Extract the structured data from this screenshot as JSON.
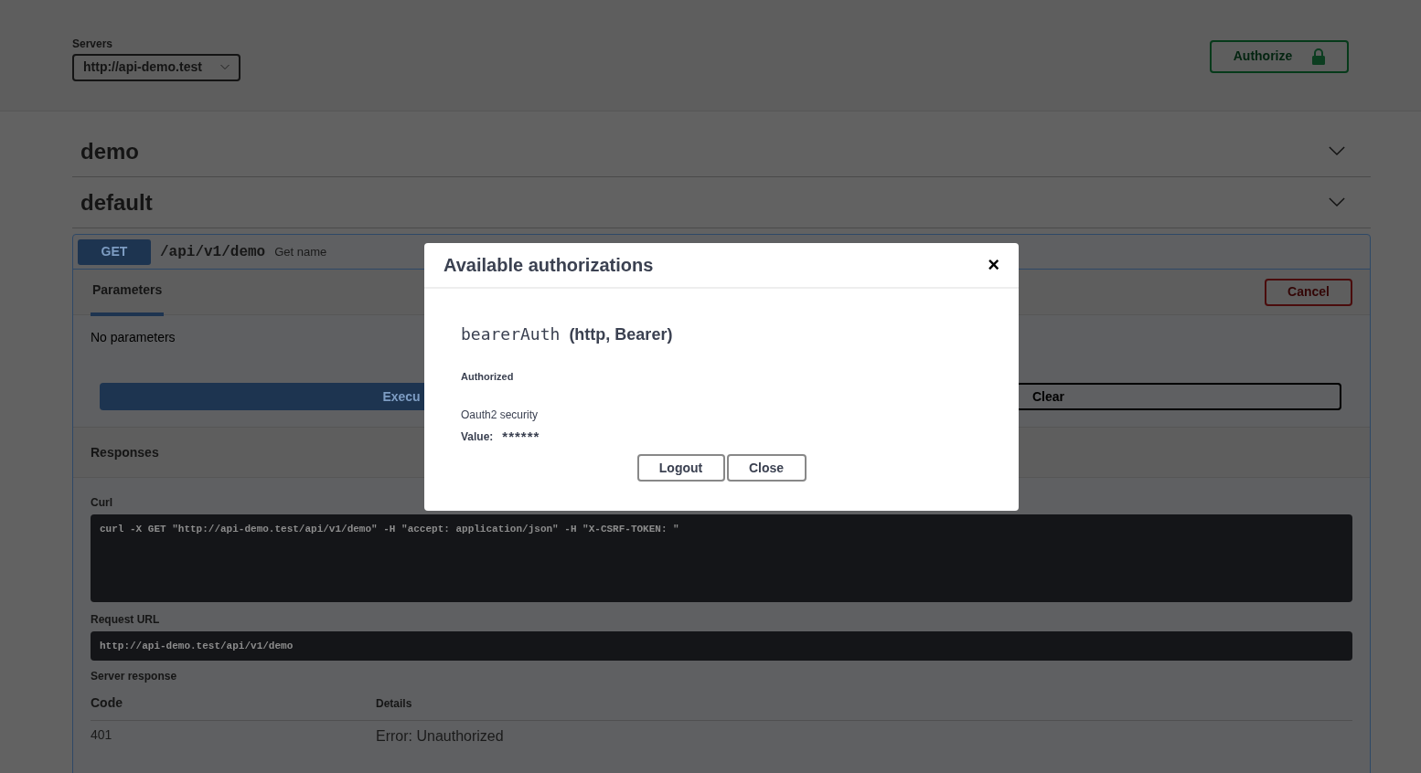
{
  "servers": {
    "label": "Servers",
    "value": "http://api-demo.test"
  },
  "authorize_button": {
    "label": "Authorize"
  },
  "sections": [
    {
      "name": "demo"
    },
    {
      "name": "default"
    }
  ],
  "operation": {
    "method": "GET",
    "path": "/api/v1/demo",
    "summary": "Get name",
    "tabs": [
      {
        "label": "Parameters",
        "selected": true
      }
    ],
    "cancel_button": "Cancel",
    "no_params": "No parameters",
    "execute_button": "Execu",
    "clear_button": "Clear",
    "responses_title": "Responses",
    "curl_label": "Curl",
    "curl": "curl -X GET \"http://api-demo.test/api/v1/demo\" -H \"accept: application/json\" -H \"X-CSRF-TOKEN: \"",
    "request_url_label": "Request URL",
    "request_url": "http://api-demo.test/api/v1/demo",
    "server_response_label": "Server response",
    "columns": [
      "Code",
      "Details"
    ],
    "rows": [
      {
        "code": "401",
        "details": "Error: Unauthorized"
      }
    ]
  },
  "modal": {
    "title": "Available authorizations",
    "close": "×",
    "scheme_name": "bearerAuth",
    "scheme_type": "(http, Bearer)",
    "status": "Authorized",
    "description": "Oauth2 security",
    "value_label": "Value:",
    "value": "******",
    "buttons": [
      "Logout",
      "Close"
    ]
  }
}
